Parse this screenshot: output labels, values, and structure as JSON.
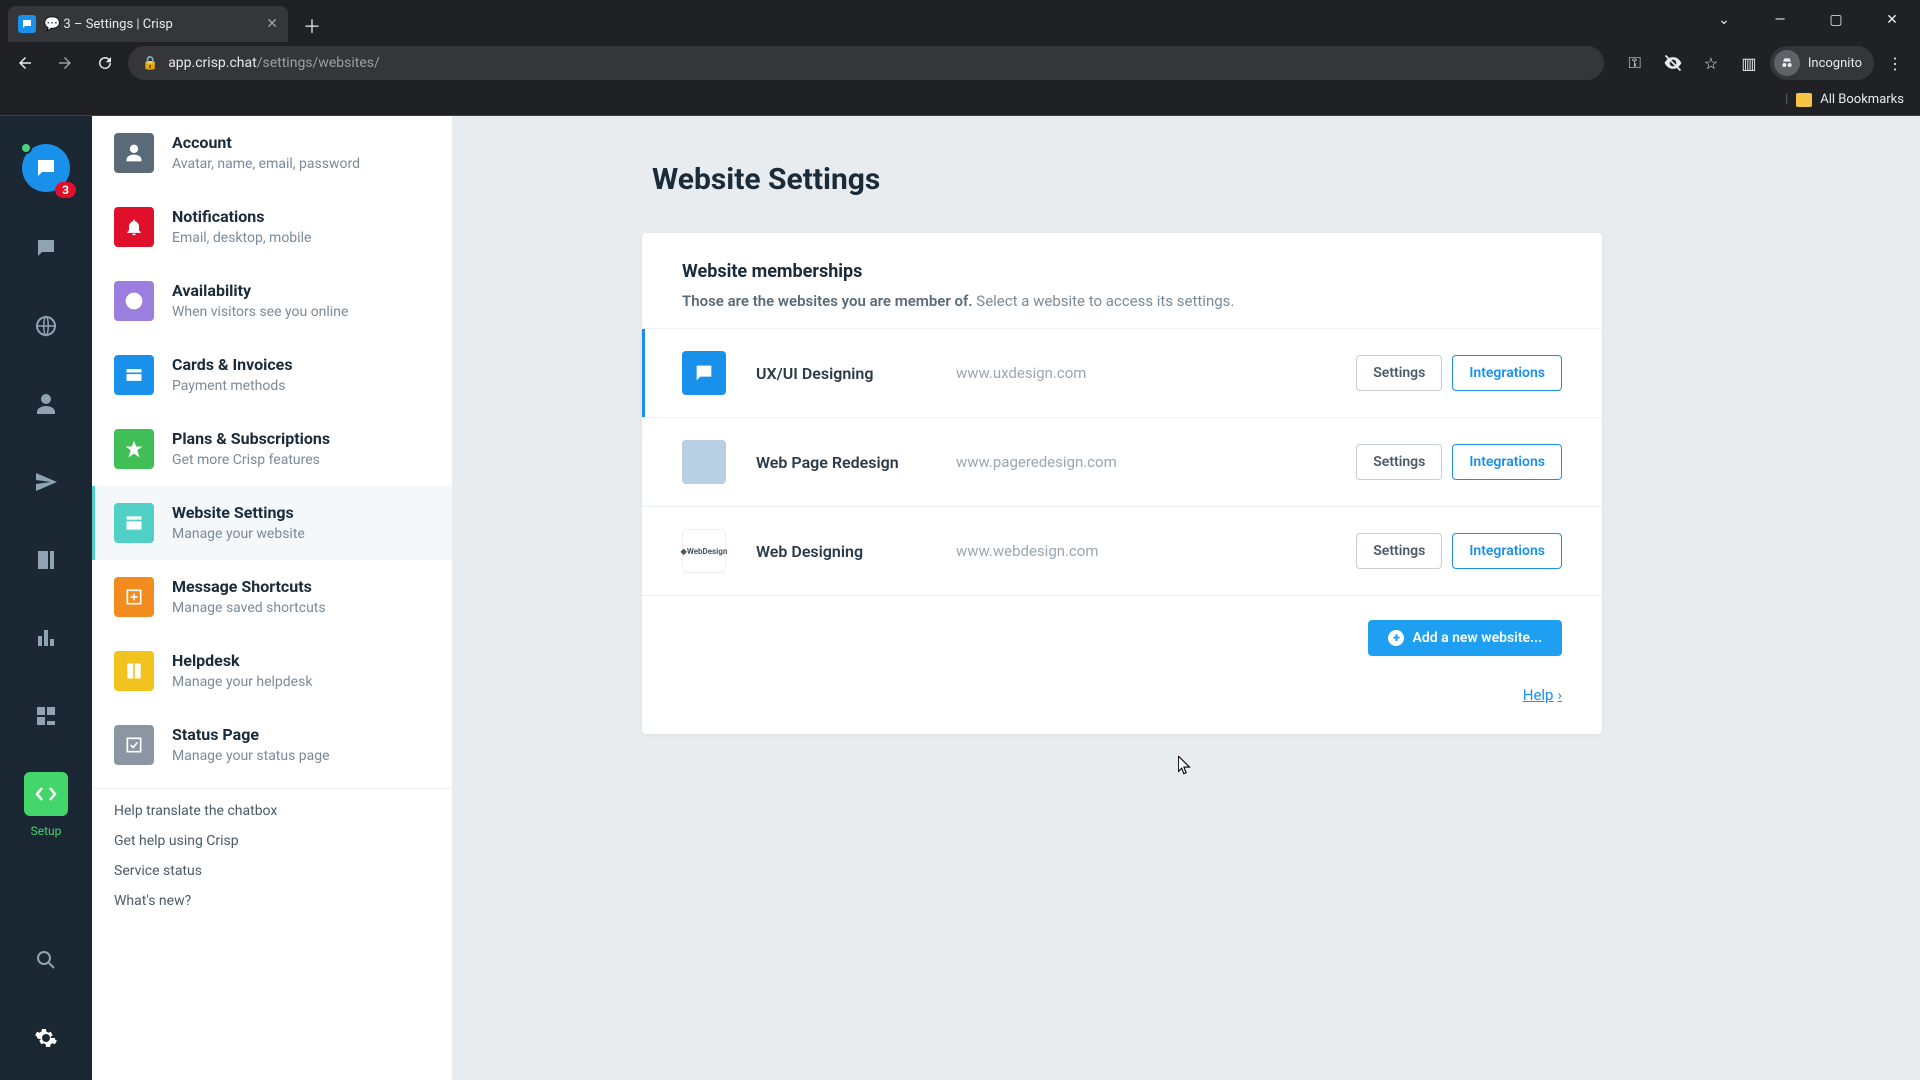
{
  "browser": {
    "tab_title": "💬 3 – Settings | Crisp",
    "url_host": "app.crisp.chat",
    "url_path": "/settings/websites/",
    "incognito_label": "Incognito",
    "bookmarks_label": "All Bookmarks"
  },
  "rail": {
    "badge_count": "3",
    "setup_label": "Setup"
  },
  "sidebar": {
    "items": [
      {
        "title": "Account",
        "sub": "Avatar, name, email, password",
        "color": "#5a6a79",
        "icon": "person"
      },
      {
        "title": "Notifications",
        "sub": "Email, desktop, mobile",
        "color": "#e0102b",
        "icon": "bell"
      },
      {
        "title": "Availability",
        "sub": "When visitors see you online",
        "color": "#9b7ede",
        "icon": "clock"
      },
      {
        "title": "Cards & Invoices",
        "sub": "Payment methods",
        "color": "#1991eb",
        "icon": "card"
      },
      {
        "title": "Plans & Subscriptions",
        "sub": "Get more Crisp features",
        "color": "#3fbf56",
        "icon": "star"
      },
      {
        "title": "Website Settings",
        "sub": "Manage your website",
        "color": "#51d0c8",
        "icon": "window",
        "selected": true
      },
      {
        "title": "Message Shortcuts",
        "sub": "Manage saved shortcuts",
        "color": "#f28c1e",
        "icon": "shortcut"
      },
      {
        "title": "Helpdesk",
        "sub": "Manage your helpdesk",
        "color": "#f2c31e",
        "icon": "book"
      },
      {
        "title": "Status Page",
        "sub": "Manage your status page",
        "color": "#8a97a3",
        "icon": "check"
      }
    ],
    "links": [
      "Help translate the chatbox",
      "Get help using Crisp",
      "Service status",
      "What's new?"
    ]
  },
  "main": {
    "title": "Website Settings",
    "section_title": "Website memberships",
    "section_sub_bold": "Those are the websites you are member of.",
    "section_sub_rest": " Select a website to access its settings.",
    "settings_label": "Settings",
    "integrations_label": "Integrations",
    "add_label": "Add a new website...",
    "help_label": "Help",
    "websites": [
      {
        "name": "UX/UI Designing",
        "url": "www.uxdesign.com",
        "logo_bg": "#1991eb",
        "logo_kind": "chat",
        "active": true
      },
      {
        "name": "Web Page Redesign",
        "url": "www.pageredesign.com",
        "logo_bg": "#b9cfe4",
        "logo_kind": "blank"
      },
      {
        "name": "Web Designing",
        "url": "www.webdesign.com",
        "logo_bg": "#ffffff",
        "logo_kind": "text"
      }
    ]
  }
}
